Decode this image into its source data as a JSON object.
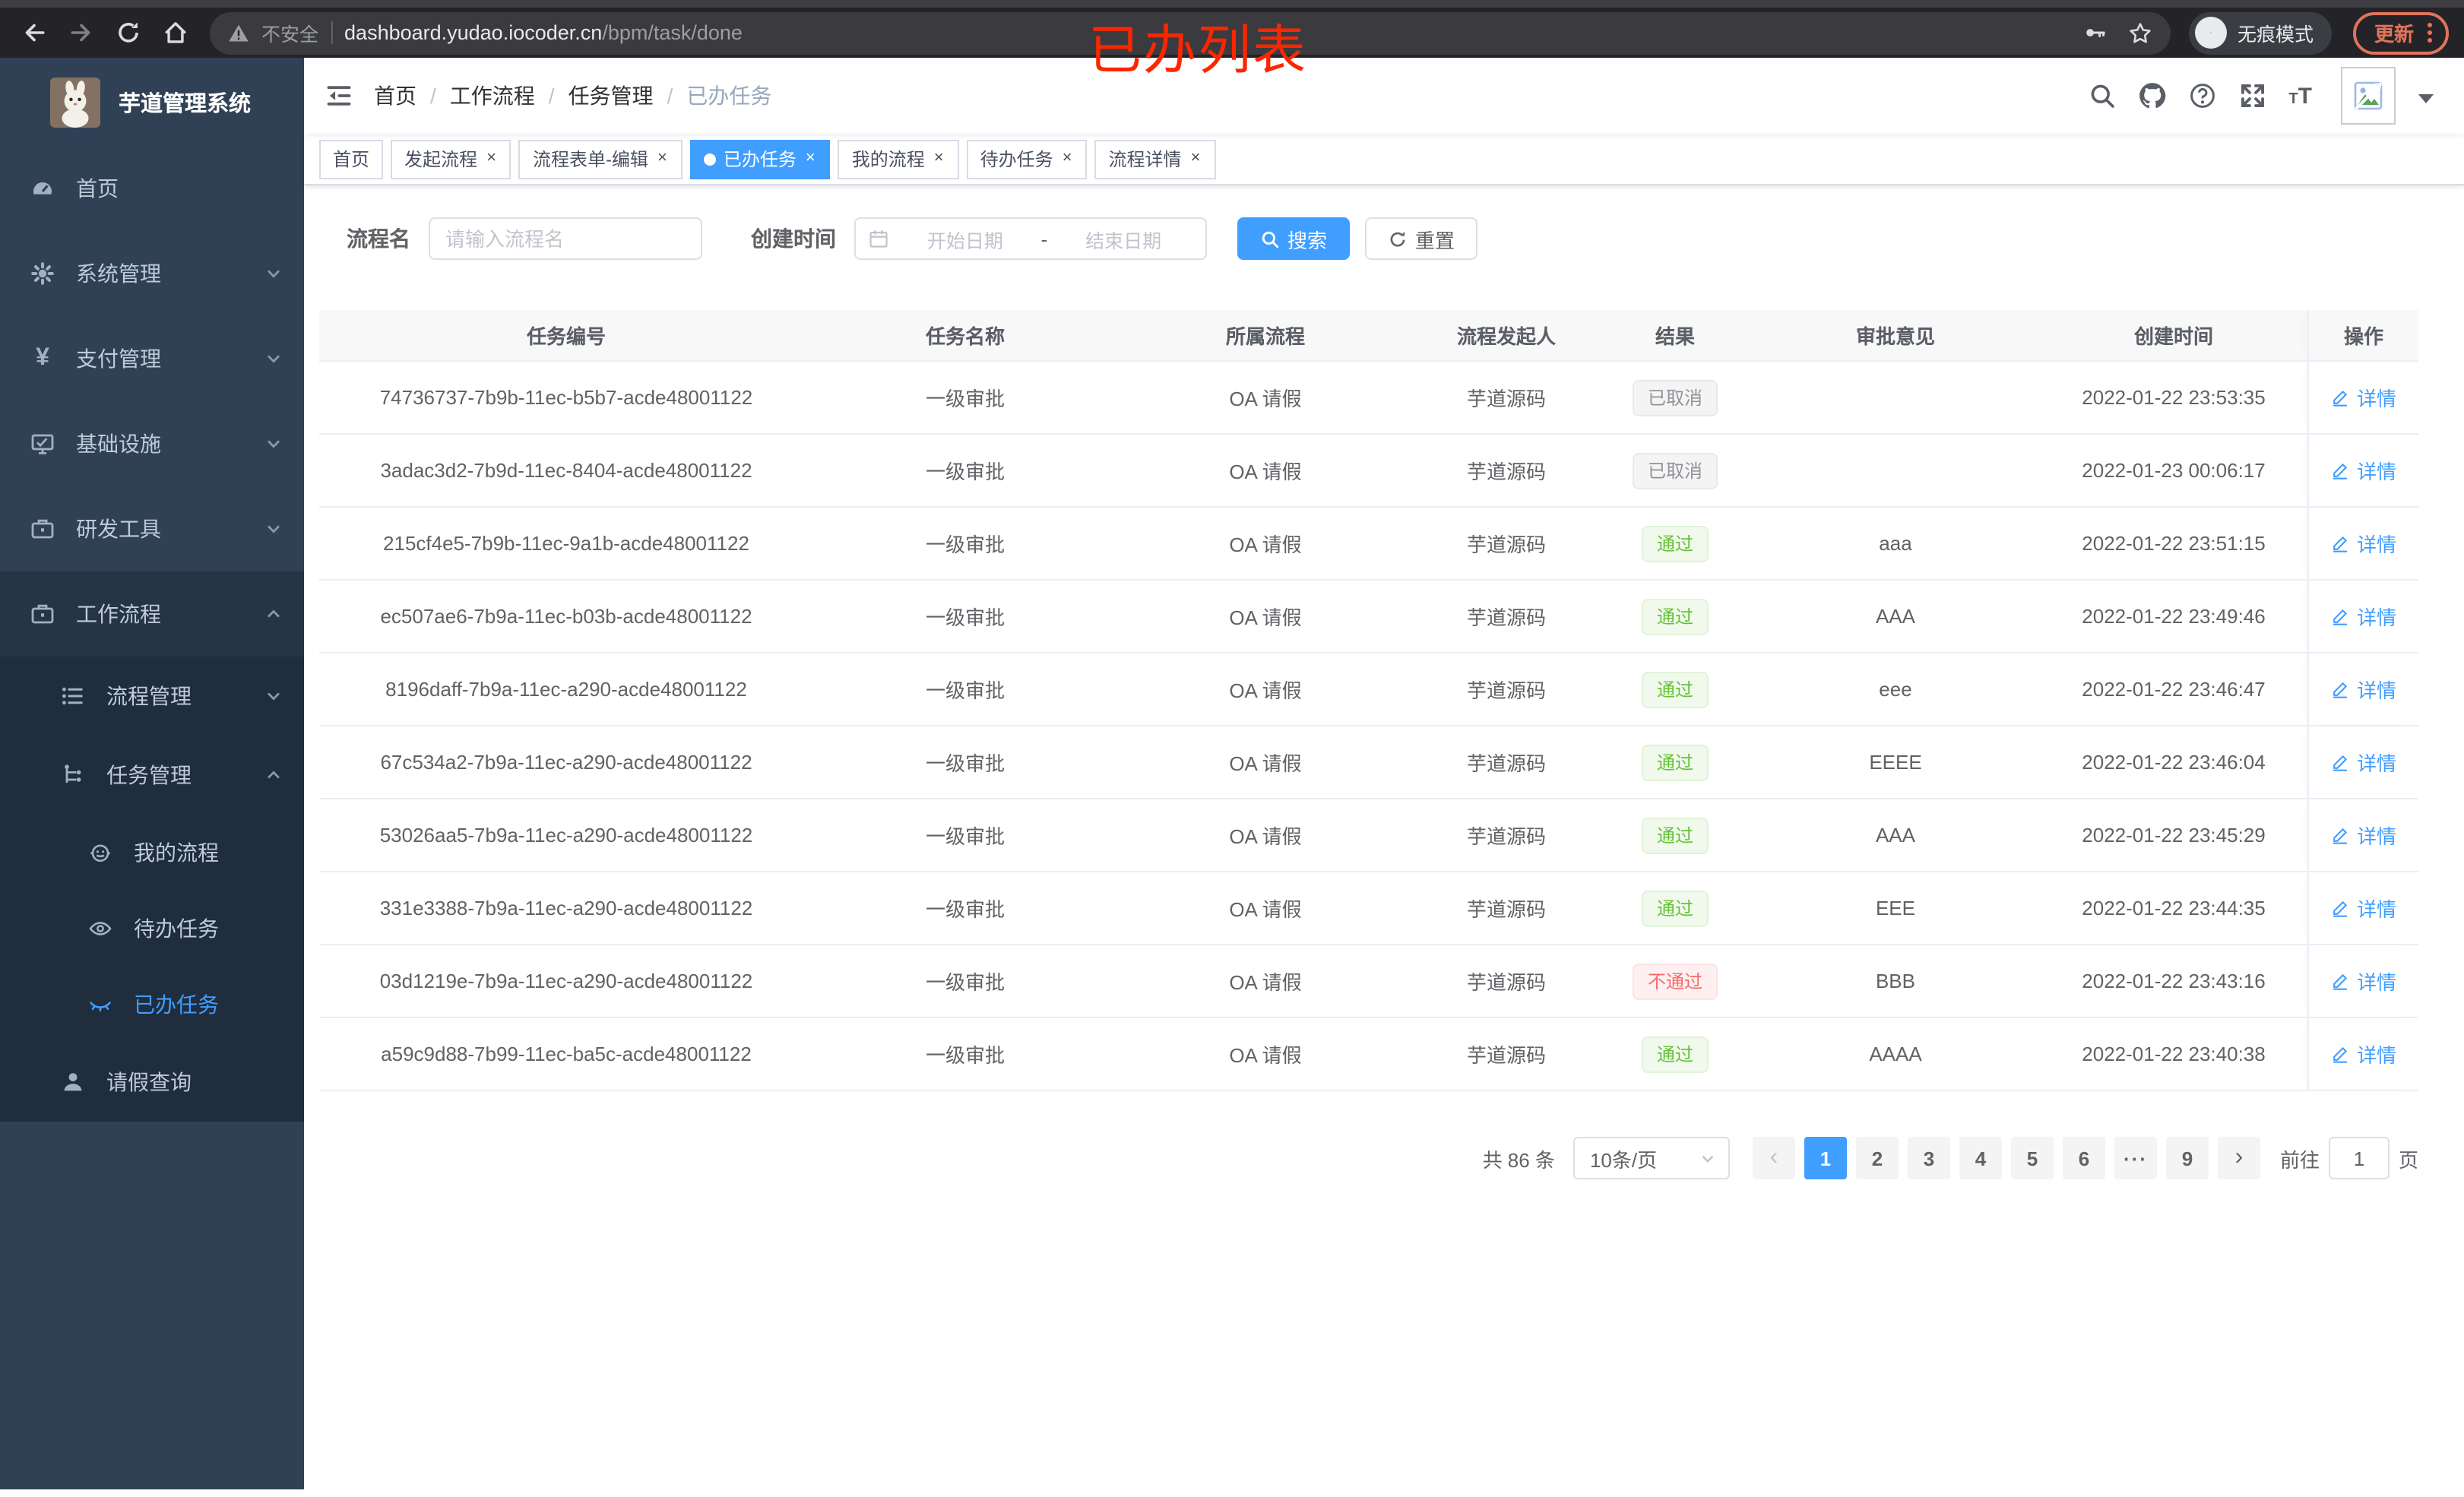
{
  "browser": {
    "security_text": "不安全",
    "url_host": "dashboard.yudao.iocoder.cn",
    "url_path": "/bpm/task/done",
    "incognito_label": "无痕模式",
    "update_label": "更新"
  },
  "annotation": {
    "text": "已办列表",
    "color": "#FB2600"
  },
  "sidebar": {
    "title": "芋道管理系统",
    "home": "首页",
    "system": "系统管理",
    "pay": "支付管理",
    "infra": "基础设施",
    "dev": "研发工具",
    "workflow": "工作流程",
    "process_mgmt": "流程管理",
    "task_mgmt": "任务管理",
    "my_process": "我的流程",
    "todo_task": "待办任务",
    "done_task": "已办任务",
    "leave_query": "请假查询"
  },
  "navbar": {
    "breadcrumb": [
      "首页",
      "工作流程",
      "任务管理",
      "已办任务"
    ]
  },
  "tabs": [
    {
      "label": "首页",
      "closable": false,
      "active": false
    },
    {
      "label": "发起流程",
      "closable": true,
      "active": false
    },
    {
      "label": "流程表单-编辑",
      "closable": true,
      "active": false
    },
    {
      "label": "已办任务",
      "closable": true,
      "active": true
    },
    {
      "label": "我的流程",
      "closable": true,
      "active": false
    },
    {
      "label": "待办任务",
      "closable": true,
      "active": false
    },
    {
      "label": "流程详情",
      "closable": true,
      "active": false
    }
  ],
  "filters": {
    "name_label": "流程名",
    "name_placeholder": "请输入流程名",
    "time_label": "创建时间",
    "start_placeholder": "开始日期",
    "range_separator": "-",
    "end_placeholder": "结束日期",
    "search_label": "搜索",
    "reset_label": "重置"
  },
  "table": {
    "headers": [
      "任务编号",
      "任务名称",
      "所属流程",
      "流程发起人",
      "结果",
      "审批意见",
      "创建时间",
      "操作"
    ],
    "action_label": "详情",
    "rows": [
      {
        "id": "74736737-7b9b-11ec-b5b7-acde48001122",
        "name": "一级审批",
        "process": "OA 请假",
        "starter": "芋道源码",
        "result": "已取消",
        "result_type": "info",
        "comment": "",
        "time": "2022-01-22 23:53:35"
      },
      {
        "id": "3adac3d2-7b9d-11ec-8404-acde48001122",
        "name": "一级审批",
        "process": "OA 请假",
        "starter": "芋道源码",
        "result": "已取消",
        "result_type": "info",
        "comment": "",
        "time": "2022-01-23 00:06:17"
      },
      {
        "id": "215cf4e5-7b9b-11ec-9a1b-acde48001122",
        "name": "一级审批",
        "process": "OA 请假",
        "starter": "芋道源码",
        "result": "通过",
        "result_type": "success",
        "comment": "aaa",
        "time": "2022-01-22 23:51:15"
      },
      {
        "id": "ec507ae6-7b9a-11ec-b03b-acde48001122",
        "name": "一级审批",
        "process": "OA 请假",
        "starter": "芋道源码",
        "result": "通过",
        "result_type": "success",
        "comment": "AAA",
        "time": "2022-01-22 23:49:46"
      },
      {
        "id": "8196daff-7b9a-11ec-a290-acde48001122",
        "name": "一级审批",
        "process": "OA 请假",
        "starter": "芋道源码",
        "result": "通过",
        "result_type": "success",
        "comment": "eee",
        "time": "2022-01-22 23:46:47"
      },
      {
        "id": "67c534a2-7b9a-11ec-a290-acde48001122",
        "name": "一级审批",
        "process": "OA 请假",
        "starter": "芋道源码",
        "result": "通过",
        "result_type": "success",
        "comment": "EEEE",
        "time": "2022-01-22 23:46:04"
      },
      {
        "id": "53026aa5-7b9a-11ec-a290-acde48001122",
        "name": "一级审批",
        "process": "OA 请假",
        "starter": "芋道源码",
        "result": "通过",
        "result_type": "success",
        "comment": "AAA",
        "time": "2022-01-22 23:45:29"
      },
      {
        "id": "331e3388-7b9a-11ec-a290-acde48001122",
        "name": "一级审批",
        "process": "OA 请假",
        "starter": "芋道源码",
        "result": "通过",
        "result_type": "success",
        "comment": "EEE",
        "time": "2022-01-22 23:44:35"
      },
      {
        "id": "03d1219e-7b9a-11ec-a290-acde48001122",
        "name": "一级审批",
        "process": "OA 请假",
        "starter": "芋道源码",
        "result": "不通过",
        "result_type": "danger",
        "comment": "BBB",
        "time": "2022-01-22 23:43:16"
      },
      {
        "id": "a59c9d88-7b99-11ec-ba5c-acde48001122",
        "name": "一级审批",
        "process": "OA 请假",
        "starter": "芋道源码",
        "result": "通过",
        "result_type": "success",
        "comment": "AAAA",
        "time": "2022-01-22 23:40:38"
      }
    ]
  },
  "pagination": {
    "total_text": "共 86 条",
    "page_size_text": "10条/页",
    "pages": [
      {
        "label": "1",
        "active": true
      },
      {
        "label": "2"
      },
      {
        "label": "3"
      },
      {
        "label": "4"
      },
      {
        "label": "5"
      },
      {
        "label": "6"
      },
      {
        "label": "···",
        "ellipsis": true
      },
      {
        "label": "9"
      }
    ],
    "goto_label": "前往",
    "goto_value": "1",
    "goto_suffix": "页"
  },
  "colors": {
    "accent": "#409EFF",
    "success": "#67C23A",
    "danger": "#F56C6C",
    "info": "#909399",
    "sidebar_bg": "#304156",
    "submenu_bg": "#1F2D3D",
    "update_button": "#E1735C",
    "annotation_red": "#FB2600"
  }
}
